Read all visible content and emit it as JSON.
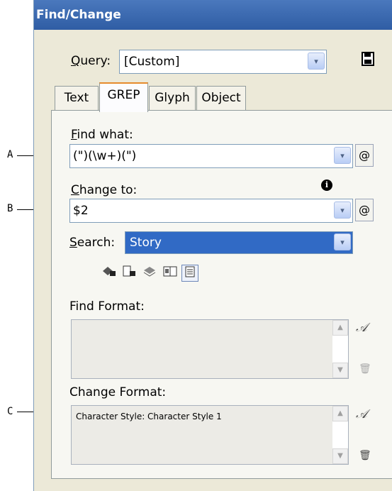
{
  "callouts": {
    "a": "A",
    "b": "B",
    "c": "C"
  },
  "window": {
    "title": "Find/Change"
  },
  "query": {
    "label_prefix": "",
    "label_u": "Q",
    "label_rest": "uery:",
    "value": "[Custom]",
    "save_icon": "save-icon"
  },
  "tabs": [
    {
      "label": "Text"
    },
    {
      "label": "GREP"
    },
    {
      "label": "Glyph"
    },
    {
      "label": "Object"
    }
  ],
  "find": {
    "label_u": "F",
    "label_rest": "ind what:",
    "value": "(\")(\\w+)(\")",
    "special_btn": "@"
  },
  "change": {
    "label_u": "C",
    "label_rest": "hange to:",
    "value": "$2",
    "special_btn": "@",
    "info_icon": "info-icon"
  },
  "search": {
    "label_u": "S",
    "label_rest": "earch:",
    "value": "Story"
  },
  "find_format": {
    "label": "Find Format:",
    "value": ""
  },
  "change_format": {
    "label": "Change Format:",
    "value": "Character Style: Character Style 1"
  },
  "icons": {
    "dropdown": "▾",
    "scroll_up": "▲",
    "scroll_down": "▼",
    "at": "@",
    "info": "i",
    "format_search": "𝒜",
    "trash": "🗑"
  }
}
